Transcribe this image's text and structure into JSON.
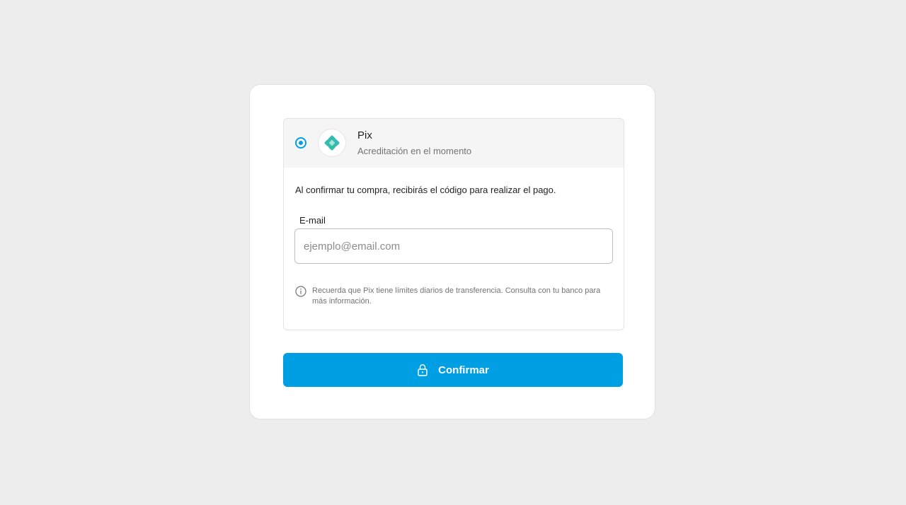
{
  "payment_method": {
    "title": "Pix",
    "subtitle": "Acreditación en el momento",
    "selected": true,
    "logo_icon": "pix-logo-icon",
    "brand_color": "#32bcad"
  },
  "body": {
    "description": "Al confirmar tu compra, recibirás el código para realizar el pago.",
    "email": {
      "label": "E-mail",
      "value": "",
      "placeholder": "ejemplo@email.com"
    },
    "info": {
      "icon": "info-icon",
      "text": "Recuerda que Pix tiene límites diarios de transferencia. Consulta con tu banco para más información."
    }
  },
  "confirm_button": {
    "label": "Confirmar",
    "icon": "lock-icon",
    "color": "#009ee3"
  }
}
